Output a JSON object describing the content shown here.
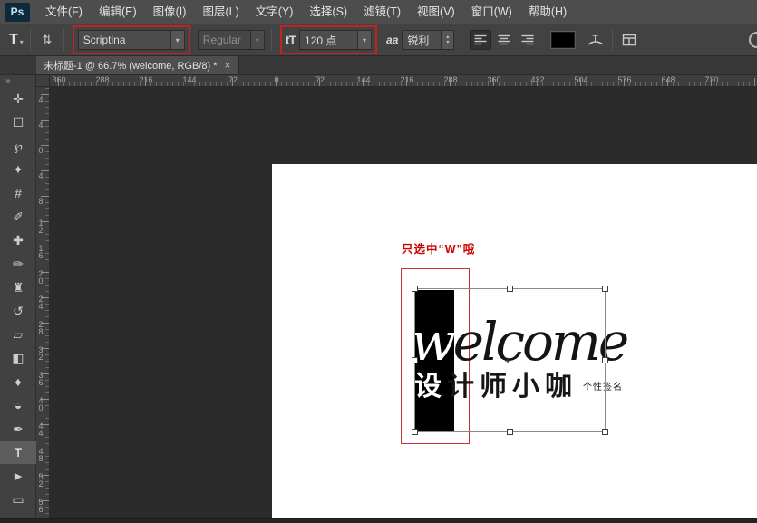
{
  "app": {
    "logo": "Ps"
  },
  "menu_bar": {
    "items": [
      "文件(F)",
      "编辑(E)",
      "图像(I)",
      "图层(L)",
      "文字(Y)",
      "选择(S)",
      "滤镜(T)",
      "视图(V)",
      "窗口(W)",
      "帮助(H)"
    ]
  },
  "options_bar": {
    "tool_preset_icon": "T",
    "tool_preset_caret": "▾",
    "orientation_icon": "⇅",
    "font_family_value": "Scriptina",
    "font_family_caret": "▾",
    "font_style_value": "Regular",
    "font_style_caret": "▾",
    "font_size_icon": "tT",
    "font_size_value": "120 点",
    "font_size_caret": "▾",
    "anti_alias_icon": "aa",
    "anti_alias_value": "锐利",
    "spinner_up": "▴",
    "spinner_down": "▾",
    "warp_icon_letter": "T"
  },
  "document_tab": {
    "title": "未标题-1 @ 66.7% (welcome, RGB/8) *",
    "close_icon": "×"
  },
  "rulers": {
    "horizontal_labels": [
      "360",
      "288",
      "216",
      "144",
      "72",
      "0",
      "72",
      "144",
      "216",
      "288",
      "360",
      "432",
      "504",
      "576",
      "648",
      "720"
    ],
    "vertical_labels": [
      "4",
      "4",
      "0",
      "4",
      "8",
      "12",
      "16",
      "20",
      "24",
      "28",
      "32",
      "36",
      "40",
      "44",
      "48",
      "52",
      "56"
    ]
  },
  "tool_panel": {
    "collapse_icon": "»",
    "tools": [
      {
        "name": "move-tool",
        "glyph": "✛",
        "state": ""
      },
      {
        "name": "rectangular-marquee-tool",
        "glyph": "☐",
        "state": ""
      },
      {
        "name": "lasso-tool",
        "glyph": "℘",
        "state": ""
      },
      {
        "name": "quick-selection-tool",
        "glyph": "✦",
        "state": ""
      },
      {
        "name": "crop-tool",
        "glyph": "#",
        "state": ""
      },
      {
        "name": "eyedropper-tool",
        "glyph": "✐",
        "state": ""
      },
      {
        "name": "spot-healing-brush-tool",
        "glyph": "✚",
        "state": ""
      },
      {
        "name": "brush-tool",
        "glyph": "✏",
        "state": ""
      },
      {
        "name": "clone-stamp-tool",
        "glyph": "♜",
        "state": ""
      },
      {
        "name": "history-brush-tool",
        "glyph": "↺",
        "state": ""
      },
      {
        "name": "eraser-tool",
        "glyph": "▱",
        "state": ""
      },
      {
        "name": "gradient-tool",
        "glyph": "◧",
        "state": ""
      },
      {
        "name": "blur-tool",
        "glyph": "♦",
        "state": ""
      },
      {
        "name": "dodge-tool",
        "glyph": "◒",
        "state": ""
      },
      {
        "name": "pen-tool",
        "glyph": "✒",
        "state": ""
      },
      {
        "name": "horizontal-type-tool",
        "glyph": "T",
        "state": "selected"
      },
      {
        "name": "path-selection-tool",
        "glyph": "►",
        "state": ""
      },
      {
        "name": "rectangle-tool",
        "glyph": "▭",
        "state": ""
      }
    ]
  },
  "canvas": {
    "annotation": "只选中“W”哦",
    "word_selected_letter": "w",
    "word_rest": "elcome",
    "headline_selected": "设",
    "headline_rest": "计师小咖",
    "signature": "个性签名",
    "center_point": "+"
  },
  "colors": {
    "highlight_box_red": "#c32222",
    "annotation_text_red": "#cc0000",
    "selection_fill_black": "#000000",
    "canvas_white": "#ffffff",
    "ui_dark_gray": "#424242"
  }
}
